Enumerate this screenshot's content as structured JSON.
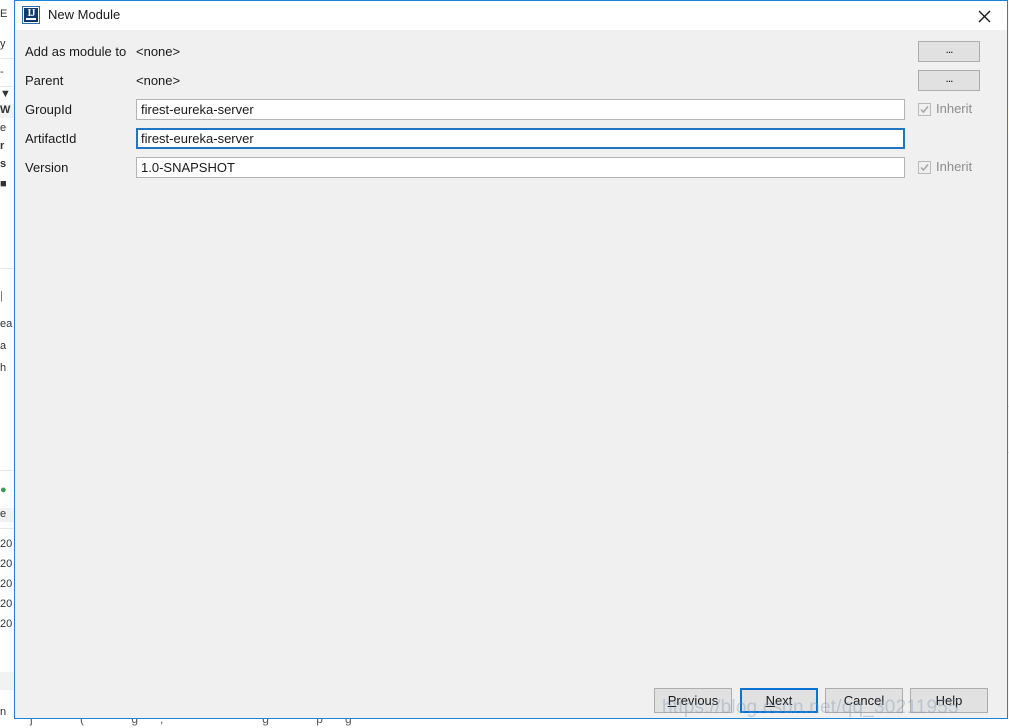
{
  "window": {
    "title": "New Module",
    "app_icon": "intellij-idea-icon",
    "close_icon": "close-icon"
  },
  "form": {
    "rows": [
      {
        "label": "Add as module to",
        "value": "<none>",
        "type": "static",
        "browse_label": "..."
      },
      {
        "label": "Parent",
        "value": "<none>",
        "type": "static",
        "browse_label": "..."
      },
      {
        "label": "GroupId",
        "value": "firest-eureka-server",
        "type": "text",
        "focused": false,
        "inherit_label": "Inherit",
        "inherit_checked": true,
        "inherit_disabled": true
      },
      {
        "label": "ArtifactId",
        "value": "firest-eureka-server",
        "type": "text",
        "focused": true,
        "inherit_label": "",
        "inherit_checked": false,
        "inherit_disabled": false
      },
      {
        "label": "Version",
        "value": "1.0-SNAPSHOT",
        "type": "text",
        "focused": false,
        "inherit_label": "Inherit",
        "inherit_checked": true,
        "inherit_disabled": true
      }
    ]
  },
  "footer": {
    "buttons": [
      {
        "name": "previous",
        "label": "Previous",
        "mnemonic": "P",
        "focused": false
      },
      {
        "name": "next",
        "label": "Next",
        "mnemonic": "N",
        "focused": true
      },
      {
        "name": "cancel",
        "label": "Cancel",
        "mnemonic": "",
        "focused": false
      },
      {
        "name": "help",
        "label": "Help",
        "mnemonic": "",
        "focused": false
      }
    ]
  },
  "watermark": {
    "text": "https://blog.csdn.net/qq_30211955"
  },
  "colors": {
    "dialog_border": "#1a84d8",
    "dialog_background": "#f0f0f0",
    "titlebar_background": "#ffffff",
    "focus_blue": "#2175c4",
    "button_face": "#e1e1e1",
    "button_border": "#adadad",
    "disabled_text": "#8d8d8d",
    "text": "#1a1a1a"
  }
}
